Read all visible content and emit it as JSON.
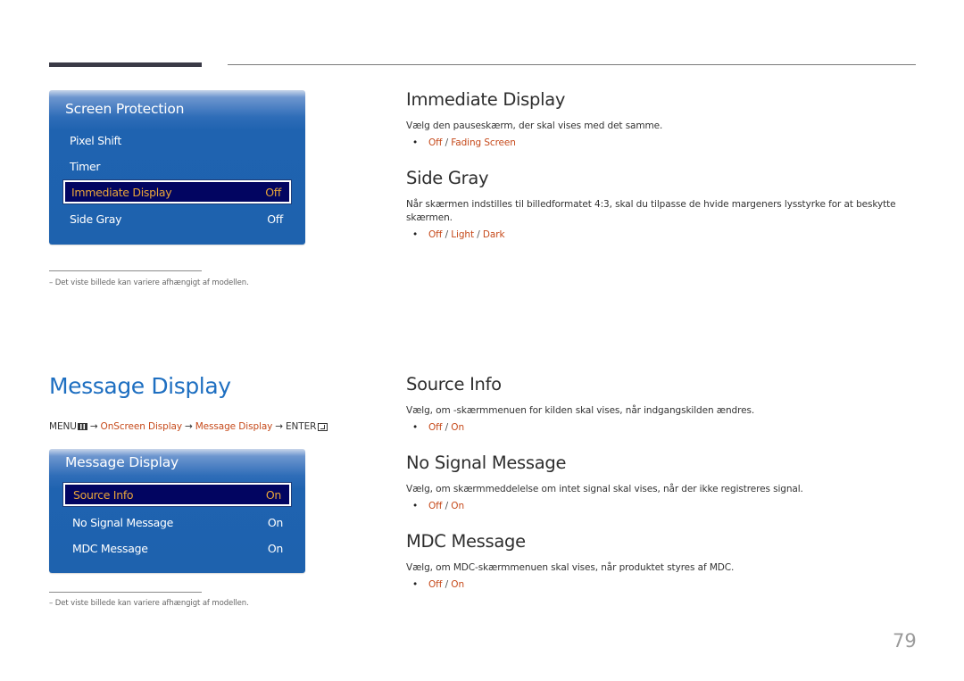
{
  "page_number": "79",
  "screen_protection_menu": {
    "title": "Screen Protection",
    "items": [
      {
        "label": "Pixel Shift",
        "value": "",
        "selected": false
      },
      {
        "label": "Timer",
        "value": "",
        "selected": false
      },
      {
        "label": "Immediate Display",
        "value": "Off",
        "selected": true
      },
      {
        "label": "Side Gray",
        "value": "Off",
        "selected": false
      }
    ]
  },
  "footnote_1": "–  Det viste billede kan variere afhængigt af modellen.",
  "immediate_display": {
    "heading": "Immediate Display",
    "description": "Vælg den pauseskærm, der skal vises med det samme.",
    "options": [
      "Off",
      "Fading Screen"
    ]
  },
  "side_gray": {
    "heading": "Side Gray",
    "description": "Når skærmen indstilles til billedformatet 4:3, skal du tilpasse de hvide margeners lysstyrke for at beskytte skærmen.",
    "options": [
      "Off",
      "Light",
      "Dark"
    ]
  },
  "message_display_section": {
    "title": "Message Display",
    "breadcrumb": {
      "menu": "MENU",
      "path": [
        "OnScreen Display",
        "Message Display"
      ],
      "enter": "ENTER",
      "arrow": "→"
    }
  },
  "message_display_menu": {
    "title": "Message Display",
    "items": [
      {
        "label": "Source Info",
        "value": "On",
        "selected": true
      },
      {
        "label": "No Signal Message",
        "value": "On",
        "selected": false
      },
      {
        "label": "MDC Message",
        "value": "On",
        "selected": false
      }
    ]
  },
  "footnote_2": "–  Det viste billede kan variere afhængigt af modellen.",
  "source_info": {
    "heading": "Source Info",
    "description": "Vælg, om -skærmmenuen for kilden skal vises, når indgangskilden ændres.",
    "options": [
      "Off",
      "On"
    ]
  },
  "no_signal_message": {
    "heading": "No Signal Message",
    "description": "Vælg, om skærmmeddelelse om intet signal skal vises, når der ikke registreres signal.",
    "options": [
      "Off",
      "On"
    ]
  },
  "mdc_message": {
    "heading": "MDC Message",
    "description": "Vælg, om MDC-skærmmenuen skal vises, når produktet styres af MDC.",
    "options": [
      "Off",
      "On"
    ]
  },
  "bullet": "•",
  "separator": " / ",
  "colors": {
    "osd_blue": "#1e62ae",
    "osd_selected_bg": "#020561",
    "osd_selected_text": "#e9a53a",
    "option_accent": "#c64a1b",
    "section_title": "#1e6fc1"
  }
}
